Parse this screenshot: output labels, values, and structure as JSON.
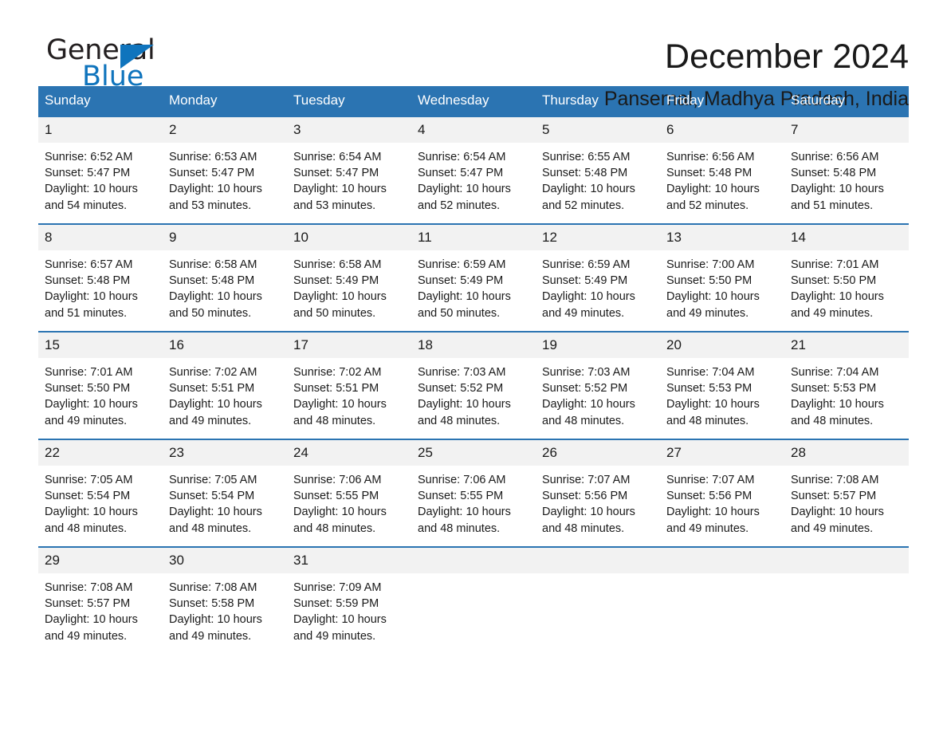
{
  "brand": {
    "name_part1": "General",
    "name_part2": "Blue",
    "accent_color": "#0f74bd"
  },
  "header": {
    "title": "December 2024",
    "subtitle": "Pansemal, Madhya Pradesh, India"
  },
  "calendar": {
    "header_color": "#2b74b2",
    "daynum_bg": "#f2f2f2",
    "weekdays": [
      "Sunday",
      "Monday",
      "Tuesday",
      "Wednesday",
      "Thursday",
      "Friday",
      "Saturday"
    ],
    "weeks": [
      [
        {
          "day": "1",
          "sunrise": "Sunrise: 6:52 AM",
          "sunset": "Sunset: 5:47 PM",
          "daylight": "Daylight: 10 hours and 54 minutes."
        },
        {
          "day": "2",
          "sunrise": "Sunrise: 6:53 AM",
          "sunset": "Sunset: 5:47 PM",
          "daylight": "Daylight: 10 hours and 53 minutes."
        },
        {
          "day": "3",
          "sunrise": "Sunrise: 6:54 AM",
          "sunset": "Sunset: 5:47 PM",
          "daylight": "Daylight: 10 hours and 53 minutes."
        },
        {
          "day": "4",
          "sunrise": "Sunrise: 6:54 AM",
          "sunset": "Sunset: 5:47 PM",
          "daylight": "Daylight: 10 hours and 52 minutes."
        },
        {
          "day": "5",
          "sunrise": "Sunrise: 6:55 AM",
          "sunset": "Sunset: 5:48 PM",
          "daylight": "Daylight: 10 hours and 52 minutes."
        },
        {
          "day": "6",
          "sunrise": "Sunrise: 6:56 AM",
          "sunset": "Sunset: 5:48 PM",
          "daylight": "Daylight: 10 hours and 52 minutes."
        },
        {
          "day": "7",
          "sunrise": "Sunrise: 6:56 AM",
          "sunset": "Sunset: 5:48 PM",
          "daylight": "Daylight: 10 hours and 51 minutes."
        }
      ],
      [
        {
          "day": "8",
          "sunrise": "Sunrise: 6:57 AM",
          "sunset": "Sunset: 5:48 PM",
          "daylight": "Daylight: 10 hours and 51 minutes."
        },
        {
          "day": "9",
          "sunrise": "Sunrise: 6:58 AM",
          "sunset": "Sunset: 5:48 PM",
          "daylight": "Daylight: 10 hours and 50 minutes."
        },
        {
          "day": "10",
          "sunrise": "Sunrise: 6:58 AM",
          "sunset": "Sunset: 5:49 PM",
          "daylight": "Daylight: 10 hours and 50 minutes."
        },
        {
          "day": "11",
          "sunrise": "Sunrise: 6:59 AM",
          "sunset": "Sunset: 5:49 PM",
          "daylight": "Daylight: 10 hours and 50 minutes."
        },
        {
          "day": "12",
          "sunrise": "Sunrise: 6:59 AM",
          "sunset": "Sunset: 5:49 PM",
          "daylight": "Daylight: 10 hours and 49 minutes."
        },
        {
          "day": "13",
          "sunrise": "Sunrise: 7:00 AM",
          "sunset": "Sunset: 5:50 PM",
          "daylight": "Daylight: 10 hours and 49 minutes."
        },
        {
          "day": "14",
          "sunrise": "Sunrise: 7:01 AM",
          "sunset": "Sunset: 5:50 PM",
          "daylight": "Daylight: 10 hours and 49 minutes."
        }
      ],
      [
        {
          "day": "15",
          "sunrise": "Sunrise: 7:01 AM",
          "sunset": "Sunset: 5:50 PM",
          "daylight": "Daylight: 10 hours and 49 minutes."
        },
        {
          "day": "16",
          "sunrise": "Sunrise: 7:02 AM",
          "sunset": "Sunset: 5:51 PM",
          "daylight": "Daylight: 10 hours and 49 minutes."
        },
        {
          "day": "17",
          "sunrise": "Sunrise: 7:02 AM",
          "sunset": "Sunset: 5:51 PM",
          "daylight": "Daylight: 10 hours and 48 minutes."
        },
        {
          "day": "18",
          "sunrise": "Sunrise: 7:03 AM",
          "sunset": "Sunset: 5:52 PM",
          "daylight": "Daylight: 10 hours and 48 minutes."
        },
        {
          "day": "19",
          "sunrise": "Sunrise: 7:03 AM",
          "sunset": "Sunset: 5:52 PM",
          "daylight": "Daylight: 10 hours and 48 minutes."
        },
        {
          "day": "20",
          "sunrise": "Sunrise: 7:04 AM",
          "sunset": "Sunset: 5:53 PM",
          "daylight": "Daylight: 10 hours and 48 minutes."
        },
        {
          "day": "21",
          "sunrise": "Sunrise: 7:04 AM",
          "sunset": "Sunset: 5:53 PM",
          "daylight": "Daylight: 10 hours and 48 minutes."
        }
      ],
      [
        {
          "day": "22",
          "sunrise": "Sunrise: 7:05 AM",
          "sunset": "Sunset: 5:54 PM",
          "daylight": "Daylight: 10 hours and 48 minutes."
        },
        {
          "day": "23",
          "sunrise": "Sunrise: 7:05 AM",
          "sunset": "Sunset: 5:54 PM",
          "daylight": "Daylight: 10 hours and 48 minutes."
        },
        {
          "day": "24",
          "sunrise": "Sunrise: 7:06 AM",
          "sunset": "Sunset: 5:55 PM",
          "daylight": "Daylight: 10 hours and 48 minutes."
        },
        {
          "day": "25",
          "sunrise": "Sunrise: 7:06 AM",
          "sunset": "Sunset: 5:55 PM",
          "daylight": "Daylight: 10 hours and 48 minutes."
        },
        {
          "day": "26",
          "sunrise": "Sunrise: 7:07 AM",
          "sunset": "Sunset: 5:56 PM",
          "daylight": "Daylight: 10 hours and 48 minutes."
        },
        {
          "day": "27",
          "sunrise": "Sunrise: 7:07 AM",
          "sunset": "Sunset: 5:56 PM",
          "daylight": "Daylight: 10 hours and 49 minutes."
        },
        {
          "day": "28",
          "sunrise": "Sunrise: 7:08 AM",
          "sunset": "Sunset: 5:57 PM",
          "daylight": "Daylight: 10 hours and 49 minutes."
        }
      ],
      [
        {
          "day": "29",
          "sunrise": "Sunrise: 7:08 AM",
          "sunset": "Sunset: 5:57 PM",
          "daylight": "Daylight: 10 hours and 49 minutes."
        },
        {
          "day": "30",
          "sunrise": "Sunrise: 7:08 AM",
          "sunset": "Sunset: 5:58 PM",
          "daylight": "Daylight: 10 hours and 49 minutes."
        },
        {
          "day": "31",
          "sunrise": "Sunrise: 7:09 AM",
          "sunset": "Sunset: 5:59 PM",
          "daylight": "Daylight: 10 hours and 49 minutes."
        },
        {
          "day": "",
          "sunrise": "",
          "sunset": "",
          "daylight": ""
        },
        {
          "day": "",
          "sunrise": "",
          "sunset": "",
          "daylight": ""
        },
        {
          "day": "",
          "sunrise": "",
          "sunset": "",
          "daylight": ""
        },
        {
          "day": "",
          "sunrise": "",
          "sunset": "",
          "daylight": ""
        }
      ]
    ]
  }
}
